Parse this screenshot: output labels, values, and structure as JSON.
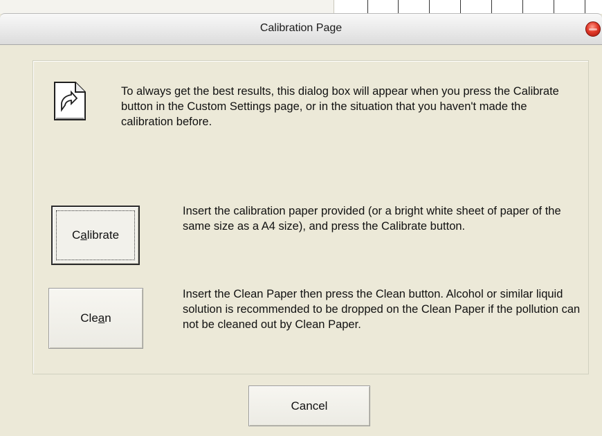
{
  "window": {
    "title": "Calibration Page"
  },
  "intro": {
    "text": "To always get the best results, this dialog box will appear when you press the Calibrate button in the Custom Settings page, or in the situation that you haven't made the calibration before."
  },
  "calibrate": {
    "label_pre": "C",
    "label_accel": "a",
    "label_post": "librate",
    "description": "Insert the calibration paper provided (or a bright white sheet of paper of the same size as a A4 size), and press the Calibrate button."
  },
  "clean": {
    "label_pre": "Cle",
    "label_accel": "a",
    "label_post": "n",
    "description": "Insert the Clean Paper then press the Clean button. Alcohol or similar liquid solution is recommended to be dropped on the Clean Paper if the pollution can not be cleaned out by Clean Paper."
  },
  "cancel": {
    "label": "Cancel"
  },
  "icons": {
    "close": "close-icon",
    "document": "document-arrow-icon"
  },
  "colors": {
    "dialog_bg": "#ece9d8",
    "close_red": "#e23a2a"
  }
}
